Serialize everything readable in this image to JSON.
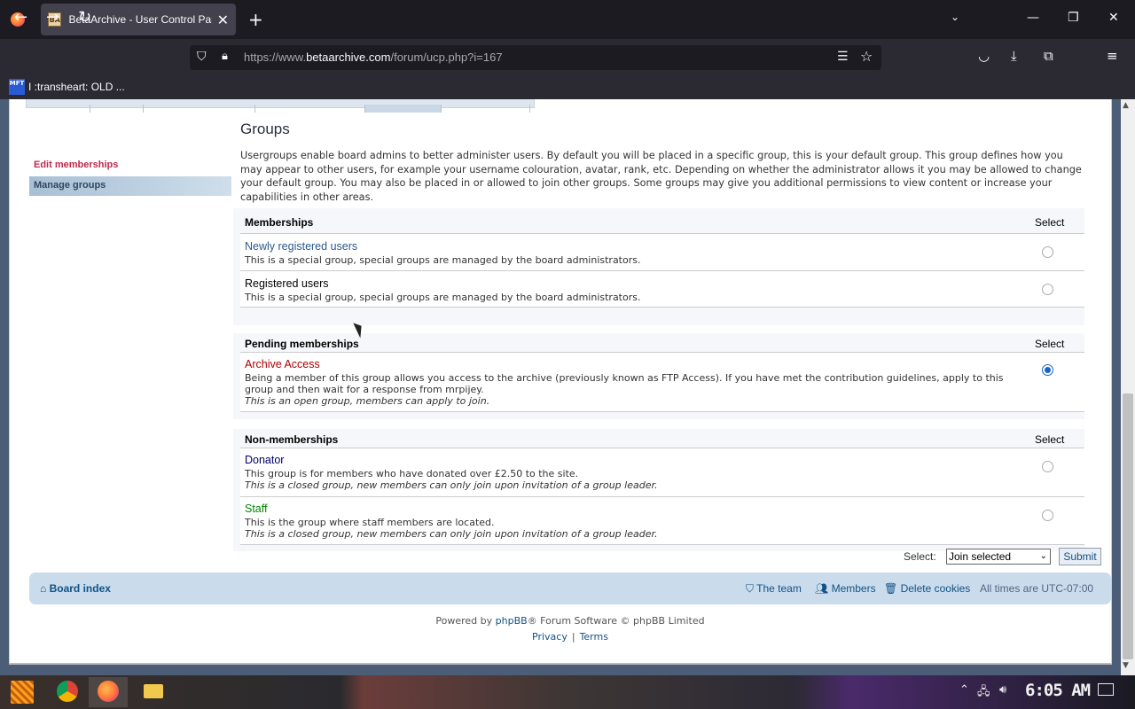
{
  "browser": {
    "tab_title": "BetaArchive - User Control Panel",
    "tab_favicon_text": "BA",
    "url_prefix": "https://www.",
    "url_domain": "betaarchive.com",
    "url_path": "/forum/ucp.php?i=167",
    "bookmark_label": "I :transheart: OLD ...",
    "bookmark_icon_text": "MFT"
  },
  "sidebar": {
    "items": [
      {
        "label": "Edit memberships"
      },
      {
        "label": "Manage groups"
      }
    ]
  },
  "main": {
    "title": "Groups",
    "intro": "Usergroups enable board admins to better administer users. By default you will be placed in a specific group, this is your default group. This group defines how you may appear to other users, for example your username colouration, avatar, rank, etc. Depending on whether the administrator allows it you may be allowed to change your default group. You may also be placed in or allowed to join other groups. Some groups may give you additional permissions to view content or increase your capabilities in other areas.",
    "select_header": "Select",
    "sections": [
      {
        "heading": "Memberships",
        "groups": [
          {
            "name": "Newly registered users",
            "color": "#2a5b8a",
            "desc": "This is a special group, special groups are managed by the board administrators.",
            "note": "",
            "selected": false
          },
          {
            "name": "Registered users",
            "color": "#000000",
            "desc": "This is a special group, special groups are managed by the board administrators.",
            "note": "",
            "selected": false
          }
        ]
      },
      {
        "heading": "Pending memberships",
        "groups": [
          {
            "name": "Archive Access",
            "color": "#aa0000",
            "desc": "Being a member of this group allows you access to the archive (previously known as FTP Access). If you have met the contribution guidelines, apply to this group and then wait for a response from mrpijey.",
            "note": "This is an open group, members can apply to join.",
            "selected": true
          }
        ]
      },
      {
        "heading": "Non-memberships",
        "groups": [
          {
            "name": "Donator",
            "color": "#000066",
            "desc": "This group is for members who have donated over £2.50 to the site.",
            "note": "This is a closed group, new members can only join upon invitation of a group leader.",
            "selected": false
          },
          {
            "name": "Staff",
            "color": "#008800",
            "desc": "This is the group where staff members are located.",
            "note": "This is a closed group, new members can only join upon invitation of a group leader.",
            "selected": false
          }
        ]
      }
    ],
    "action_label": "Select:",
    "action_value": "Join selected",
    "submit_label": "Submit"
  },
  "footer": {
    "board_index": "Board index",
    "the_team": "The team",
    "members": "Members",
    "delete_cookies": "Delete cookies",
    "timezone": "All times are UTC-07:00",
    "powered_by": "Powered by",
    "phpbb": "phpBB",
    "powered_rest": "® Forum Software © phpBB Limited",
    "privacy": "Privacy",
    "terms": "Terms"
  },
  "taskbar": {
    "clock": "6:05 AM"
  }
}
